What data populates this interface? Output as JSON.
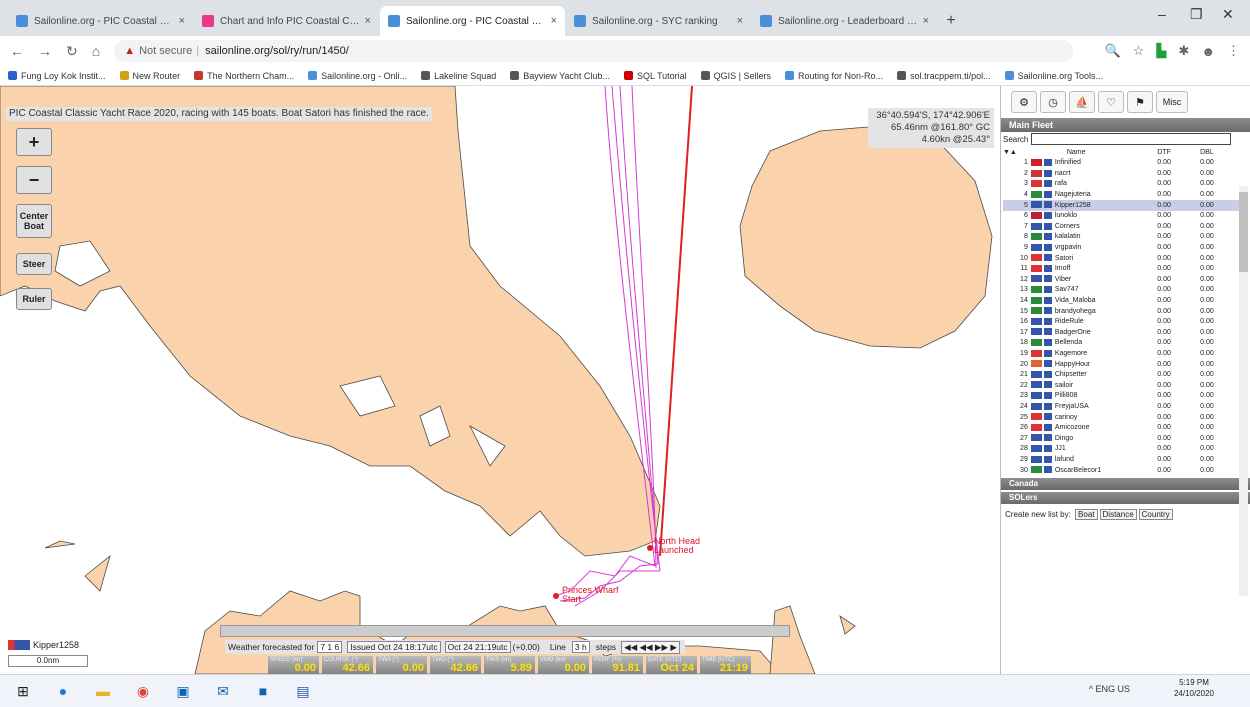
{
  "browser": {
    "tabs": [
      {
        "title": "Sailonline.org - PIC Coastal Clas",
        "active": false,
        "icon": "sailonline-favicon"
      },
      {
        "title": "Chart and Info PIC Coastal Clas",
        "active": false,
        "icon": "chart-favicon"
      },
      {
        "title": "Sailonline.org - PIC Coastal Clas",
        "active": true,
        "icon": "sailonline-favicon"
      },
      {
        "title": "Sailonline.org - SYC ranking",
        "active": false,
        "icon": "sailonline-favicon"
      },
      {
        "title": "Sailonline.org - Leaderboard for",
        "active": false,
        "icon": "sailonline-favicon"
      }
    ],
    "close_glyph": "×",
    "new_tab_glyph": "+",
    "window_controls": {
      "minimize": "–",
      "restore": "❐",
      "close": "✕"
    },
    "nav": {
      "back": "←",
      "forward": "→",
      "reload": "↻",
      "home": "⌂"
    },
    "security_label": "Not secure",
    "url": "sailonline.org/sol/ry/run/1450/",
    "bookmarks": [
      {
        "label": "Fung Loy Kok Instit...",
        "color": "#2c62c7"
      },
      {
        "label": "New Router",
        "color": "#d4a017"
      },
      {
        "label": "The Northern Cham...",
        "color": "#c0392b"
      },
      {
        "label": "Sailonline.org - Onli...",
        "color": "#4a8fd8"
      },
      {
        "label": "Lakeline Squad",
        "color": "#555555"
      },
      {
        "label": "Bayview Yacht Club...",
        "color": "#555555"
      },
      {
        "label": "SQL Tutorial",
        "color": "#cc0000"
      },
      {
        "label": "QGIS | Sellers",
        "color": "#555555"
      },
      {
        "label": "Routing for Non-Ro...",
        "color": "#4a8fd8"
      },
      {
        "label": "sol.tracppem.ti/pol...",
        "color": "#555555"
      },
      {
        "label": "Sailonline.org Tools...",
        "color": "#4a8fd8"
      }
    ]
  },
  "map": {
    "status": "PIC Coastal Classic Yacht Race 2020, racing with 145 boats. Boat Satori has finished the race.",
    "coords_line1": "36°40.594'S, 174°42.906'E",
    "coords_line2": "65.46nm @161.80° GC",
    "coords_line3": "4.60kn @25.43°",
    "buttons": {
      "zoom_in": "+",
      "zoom_out": "−",
      "center": "Center Boat",
      "steer": "Steer",
      "ruler": "Ruler"
    },
    "labels": {
      "north_head": "North Head",
      "north_head_sub": "Launched",
      "princes_wharf": "Princes Wharf",
      "princes_wharf_sub": "Start"
    },
    "land_color": "#fad2ac",
    "track_color": "#d43ad4"
  },
  "bottom": {
    "boat_name": "Kipper1258",
    "scale": "0.0nm",
    "weather_label": "Weather forecasted for",
    "weather_value": "7 1 6",
    "issued": "Issued Oct 24 18:17utc",
    "time": "Oct 24 21:19utc",
    "offset": "(+0.00)",
    "line_label": "Line",
    "line_value": "3 h",
    "steps_label": "steps",
    "playback": "◀◀ ◀◀ ▶▶ ▶",
    "dash": [
      {
        "label": "SPEED (kn)",
        "value": "0.00"
      },
      {
        "label": "COURSE (°)",
        "value": "42.66"
      },
      {
        "label": "TWA (°)",
        "value": "0.00"
      },
      {
        "label": "TWD (°)",
        "value": "42.66"
      },
      {
        "label": "TWS (kn)",
        "value": "5.89"
      },
      {
        "label": "VMG (kn)",
        "value": "0.00"
      },
      {
        "label": "PERF (%)",
        "value": "91.81"
      },
      {
        "label": "DATE (UTC)",
        "value": "Oct 24"
      },
      {
        "label": "TIME (UTC)",
        "value": "21:19"
      }
    ]
  },
  "sidebar": {
    "tabs": [
      "⚙",
      "◷",
      "⛵",
      "♡",
      "⚑",
      "Misc"
    ],
    "main_fleet": "Main Fleet",
    "search_label": "Search",
    "columns": {
      "rank": "▼▲",
      "name": "Name",
      "dtf": "DTF",
      "dbl": "DBL"
    },
    "boats": [
      {
        "rank": "1",
        "name": "Infinified",
        "flag": "#cc2222",
        "dtf": "0.00",
        "dbl": "0.00"
      },
      {
        "rank": "2",
        "name": "nacrt",
        "flag": "#cc3333",
        "dtf": "0.00",
        "dbl": "0.00"
      },
      {
        "rank": "3",
        "name": "rafa",
        "flag": "#d33",
        "dtf": "0.00",
        "dbl": "0.00"
      },
      {
        "rank": "4",
        "name": "Nagejuteria",
        "flag": "#2a8a3a",
        "dtf": "0.00",
        "dbl": "0.00"
      },
      {
        "rank": "5",
        "name": "Kipper1258",
        "flag": "#3355aa",
        "dtf": "0.00",
        "dbl": "0.00",
        "selected": true
      },
      {
        "rank": "6",
        "name": "lunoklo",
        "flag": "#bb2233",
        "dtf": "0.00",
        "dbl": "0.00"
      },
      {
        "rank": "7",
        "name": "Corners",
        "flag": "#3355aa",
        "dtf": "0.00",
        "dbl": "0.00"
      },
      {
        "rank": "8",
        "name": "kalalatin",
        "flag": "#2a8a3a",
        "dtf": "0.00",
        "dbl": "0.00"
      },
      {
        "rank": "9",
        "name": "vrgpavin",
        "flag": "#3355aa",
        "dtf": "0.00",
        "dbl": "0.00"
      },
      {
        "rank": "10",
        "name": "Satori",
        "flag": "#dd3333",
        "dtf": "0.00",
        "dbl": "0.00"
      },
      {
        "rank": "11",
        "name": "Imoff",
        "flag": "#dd3333",
        "dtf": "0.00",
        "dbl": "0.00"
      },
      {
        "rank": "12",
        "name": "Viber",
        "flag": "#3355aa",
        "dtf": "0.00",
        "dbl": "0.00"
      },
      {
        "rank": "13",
        "name": "Sav747",
        "flag": "#2a8a3a",
        "dtf": "0.00",
        "dbl": "0.00"
      },
      {
        "rank": "14",
        "name": "Vida_Maloba",
        "flag": "#2a8a3a",
        "dtf": "0.00",
        "dbl": "0.00"
      },
      {
        "rank": "15",
        "name": "brandyohega",
        "flag": "#2a8a3a",
        "dtf": "0.00",
        "dbl": "0.00"
      },
      {
        "rank": "16",
        "name": "RideRule",
        "flag": "#3355aa",
        "dtf": "0.00",
        "dbl": "0.00"
      },
      {
        "rank": "17",
        "name": "BadgerOne",
        "flag": "#3355aa",
        "dtf": "0.00",
        "dbl": "0.00"
      },
      {
        "rank": "18",
        "name": "Bellenda",
        "flag": "#2a8a3a",
        "dtf": "0.00",
        "dbl": "0.00"
      },
      {
        "rank": "19",
        "name": "Kagemore",
        "flag": "#dd3333",
        "dtf": "0.00",
        "dbl": "0.00"
      },
      {
        "rank": "20",
        "name": "HappyHour",
        "flag": "#dd6633",
        "dtf": "0.00",
        "dbl": "0.00"
      },
      {
        "rank": "21",
        "name": "Chipsetter",
        "flag": "#3355aa",
        "dtf": "0.00",
        "dbl": "0.00"
      },
      {
        "rank": "22",
        "name": "sailoir",
        "flag": "#3355aa",
        "dtf": "0.00",
        "dbl": "0.00"
      },
      {
        "rank": "23",
        "name": "Pilli808",
        "flag": "#3355aa",
        "dtf": "0.00",
        "dbl": "0.00"
      },
      {
        "rank": "24",
        "name": "FreyjaUSA",
        "flag": "#3355aa",
        "dtf": "0.00",
        "dbl": "0.00"
      },
      {
        "rank": "25",
        "name": "carinoy",
        "flag": "#dd3333",
        "dtf": "0.00",
        "dbl": "0.00"
      },
      {
        "rank": "26",
        "name": "Amicozone",
        "flag": "#dd3333",
        "dtf": "0.00",
        "dbl": "0.00"
      },
      {
        "rank": "27",
        "name": "Dingo",
        "flag": "#3355aa",
        "dtf": "0.00",
        "dbl": "0.00"
      },
      {
        "rank": "28",
        "name": "JJ1",
        "flag": "#3355aa",
        "dtf": "0.00",
        "dbl": "0.00"
      },
      {
        "rank": "29",
        "name": "lafund",
        "flag": "#3355aa",
        "dtf": "0.00",
        "dbl": "0.00"
      },
      {
        "rank": "30",
        "name": "OscarBelecor1",
        "flag": "#2a8a3a",
        "dtf": "0.00",
        "dbl": "0.00"
      }
    ],
    "canada": "Canada",
    "sol_ers": "SOLers",
    "list_label": "Create new list by:",
    "list_buttons": [
      "Boat",
      "Distance",
      "Country"
    ]
  },
  "taskbar": {
    "time": "5:19 PM",
    "date": "24/10/2020",
    "tray": "^ ENG US"
  }
}
